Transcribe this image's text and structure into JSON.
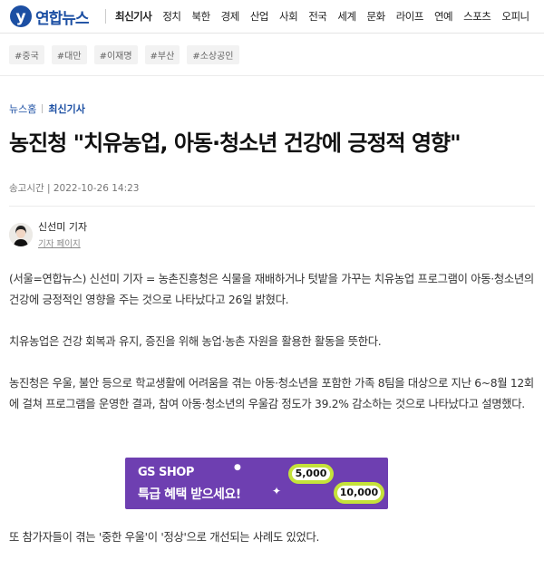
{
  "header": {
    "logo_text": "연합뉴스",
    "nav": [
      "최신기사",
      "정치",
      "북한",
      "경제",
      "산업",
      "사회",
      "전국",
      "세계",
      "문화",
      "라이프",
      "연예",
      "스포츠",
      "오피니"
    ]
  },
  "tags": [
    "#중국",
    "#대만",
    "#이재명",
    "#부산",
    "#소상공인"
  ],
  "breadcrumb": {
    "home": "뉴스홈",
    "current": "최신기사"
  },
  "article": {
    "title": "농진청 \"치유농업, 아동·청소년 건강에 긍정적 영향\"",
    "meta": "송고시간 | 2022-10-26 14:23",
    "author_name": "신선미 기자",
    "author_link": "기자 페이지",
    "p1": "(서울=연합뉴스) 신선미 기자 = 농촌진흥청은 식물을 재배하거나 텃밭을 가꾸는 치유농업 프로그램이 아동·청소년의 건강에 긍정적인 영향을 주는 것으로 나타났다고 26일 밝혔다.",
    "p2": "치유농업은 건강 회복과 유지, 증진을 위해 농업·농촌 자원을 활용한 활동을 뜻한다.",
    "p3": "농진청은 우울, 불안 등으로 학교생활에 어려움을 겪는 아동·청소년을 포함한 가족 8팀을 대상으로 지난 6~8월 12회에 걸쳐 프로그램을 운영한 결과, 참여 아동·청소년의 우울감 정도가 39.2% 감소하는 것으로 나타났다고 설명했다.",
    "p4": "또 참가자들이 겪는 '중한 우울'이 '정상'으로 개선되는 사례도 있었다."
  },
  "ad": {
    "line1": "GS SHOP",
    "line2": "특급 혜택 받으세요!",
    "coin1": "5,000",
    "coin2": "10,000"
  }
}
